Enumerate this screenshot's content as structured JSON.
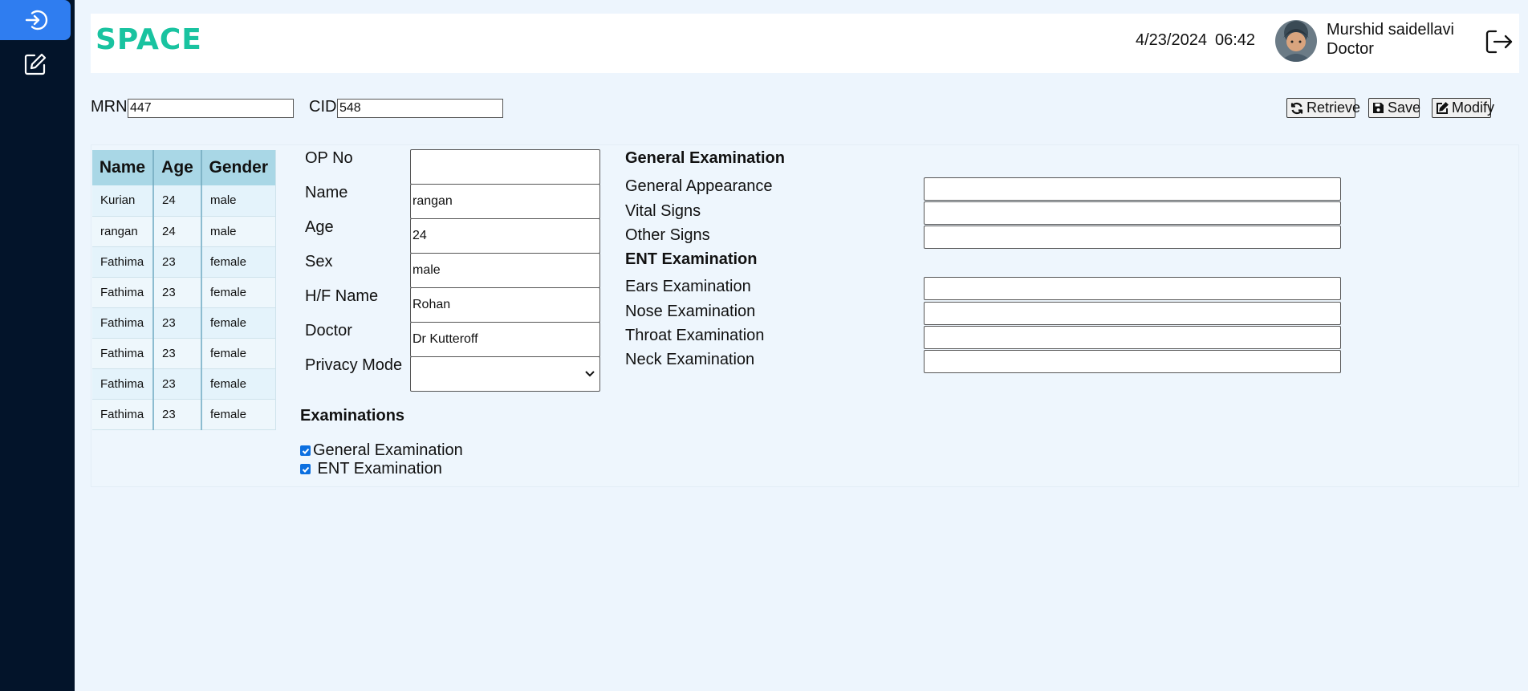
{
  "app": {
    "logo": "SPACE"
  },
  "sidebar": {
    "items": [
      {
        "icon": "login-icon",
        "active": true
      },
      {
        "icon": "edit-icon",
        "active": false
      }
    ]
  },
  "header": {
    "date": "4/23/2024",
    "time": "06:42",
    "user_name": "Murshid saidellavi",
    "user_role": "Doctor"
  },
  "search": {
    "mrn_label": "MRN",
    "mrn_value": "447",
    "cid_label": "CID",
    "cid_value": "548"
  },
  "toolbar": {
    "retrieve": "Retrieve",
    "save": "Save",
    "modify": "Modify"
  },
  "patients": {
    "columns": [
      "Name",
      "Age",
      "Gender"
    ],
    "rows": [
      [
        "Kurian",
        "24",
        "male"
      ],
      [
        "rangan",
        "24",
        "male"
      ],
      [
        "Fathima",
        "23",
        "female"
      ],
      [
        "Fathima",
        "23",
        "female"
      ],
      [
        "Fathima",
        "23",
        "female"
      ],
      [
        "Fathima",
        "23",
        "female"
      ],
      [
        "Fathima",
        "23",
        "female"
      ],
      [
        "Fathima",
        "23",
        "female"
      ]
    ]
  },
  "form": {
    "op_no": {
      "label": "OP No",
      "value": ""
    },
    "name": {
      "label": "Name",
      "value": "rangan"
    },
    "age": {
      "label": "Age",
      "value": "24"
    },
    "sex": {
      "label": "Sex",
      "value": "male"
    },
    "hf_name": {
      "label": "H/F Name",
      "value": "Rohan"
    },
    "doctor": {
      "label": "Doctor",
      "value": "Dr Kutteroff"
    },
    "privacy": {
      "label": "Privacy Mode",
      "value": ""
    }
  },
  "examinations": {
    "title": "Examinations",
    "general_label": "General Examination",
    "ent_label": " ENT Examination",
    "general_checked": true,
    "ent_checked": true
  },
  "general_exam": {
    "title": "General Examination",
    "appearance": "General Appearance",
    "vitals": "Vital Signs",
    "other": "Other Signs"
  },
  "ent_exam": {
    "title": "ENT Examination",
    "ears": "Ears Examination",
    "nose": "Nose Examination",
    "throat": "Throat Examination",
    "neck": "Neck Examination"
  },
  "colors": {
    "sidebar": "#03142a",
    "accent": "#2f7df0",
    "logo": "#19c3a0",
    "table_header": "#a9d7e6"
  }
}
